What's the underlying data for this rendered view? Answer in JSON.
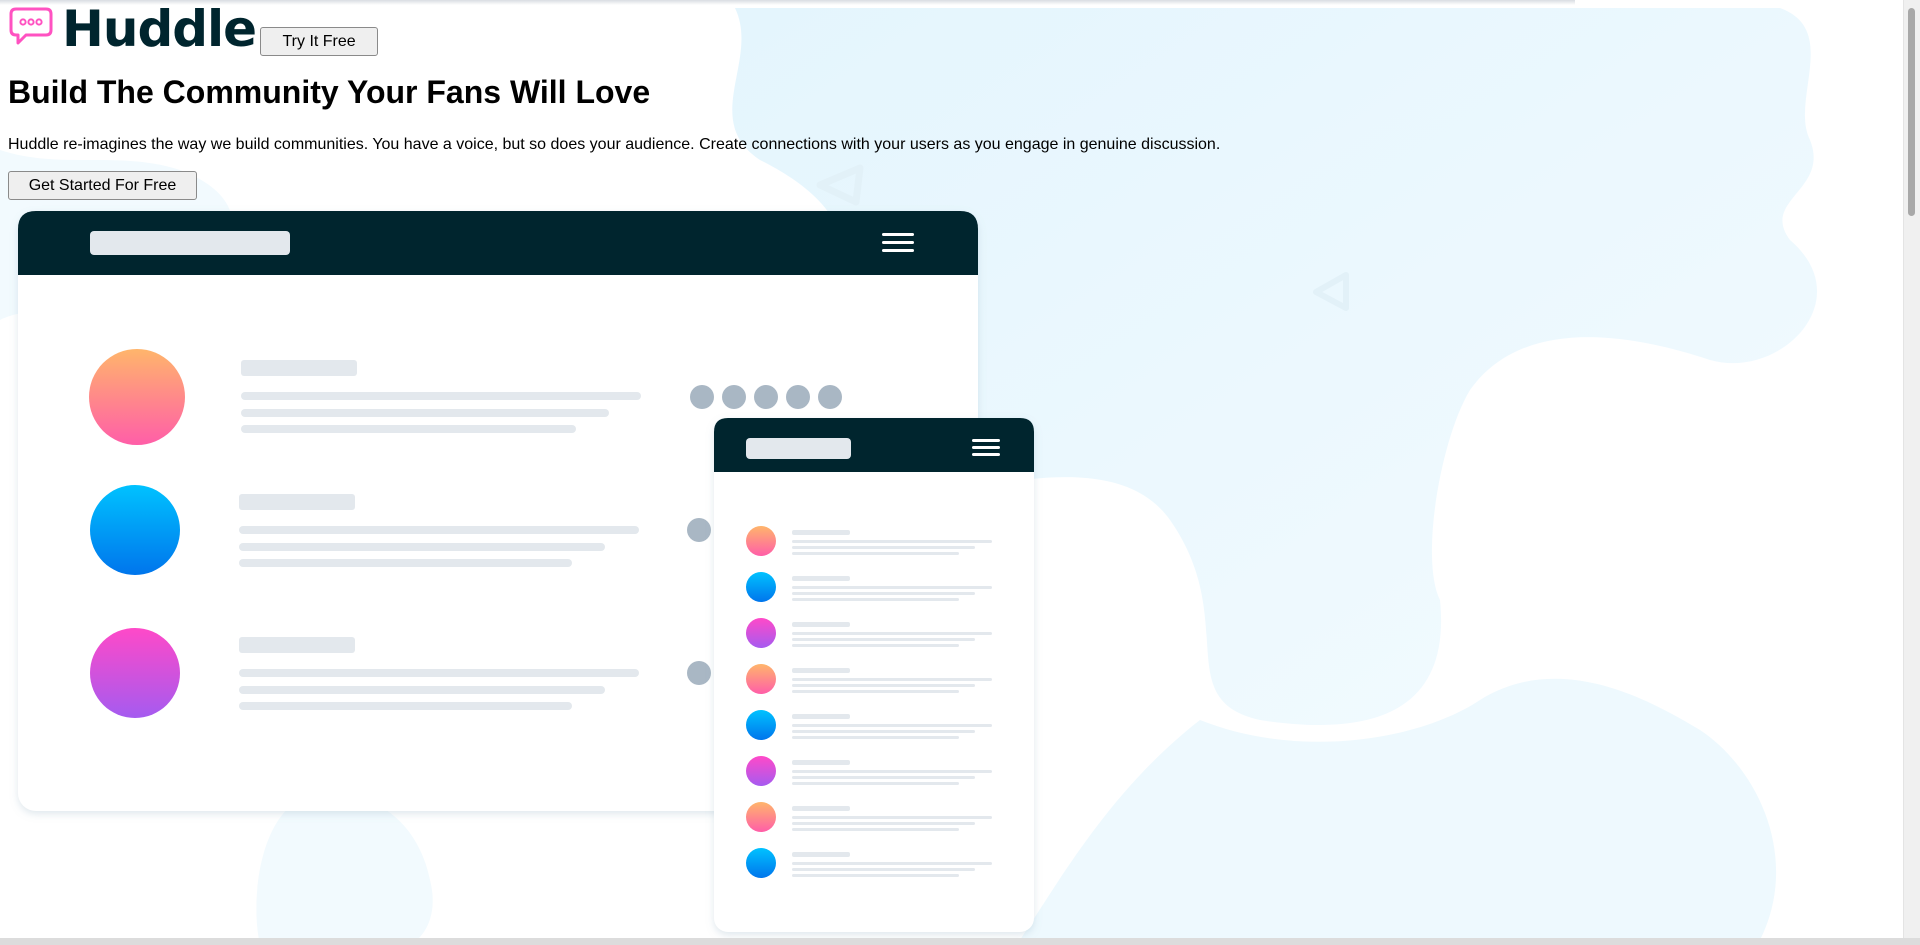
{
  "brand": {
    "name": "Huddle"
  },
  "header": {
    "try_label": "Try It Free"
  },
  "hero": {
    "title": "Build The Community Your Fans Will Love",
    "description": "Huddle re-imagines the way we build communities. You have a voice, but so does your audience. Create connections with your users as you engage in genuine discussion.",
    "cta_label": "Get Started For Free"
  },
  "icons": {
    "logo": "speech-bubble-icon",
    "menu": "hamburger-menu-icon"
  },
  "colors": {
    "brand_dark": "#00252e",
    "accent_pink": "#ff52c1",
    "background_blob": "#e9f7fe",
    "placeholder": "#e3e8ed",
    "dot": "#a9b7c4"
  }
}
